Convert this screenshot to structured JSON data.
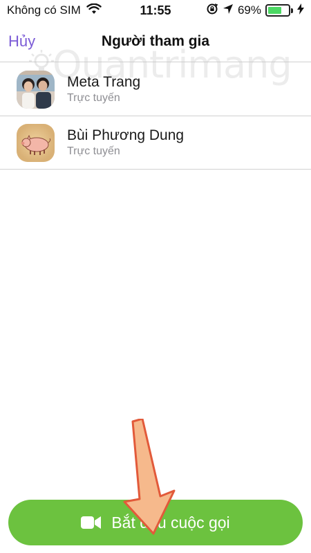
{
  "status_bar": {
    "carrier": "Không có SIM",
    "time": "11:55",
    "battery_percent": "69%",
    "battery_level": 0.69
  },
  "nav": {
    "cancel_label": "Hủy",
    "title": "Người tham gia"
  },
  "participants": [
    {
      "name": "Meta Trang",
      "status": "Trực tuyến",
      "avatar_icon": "photo-avatar"
    },
    {
      "name": "Bùi Phương Dung",
      "status": "Trực tuyến",
      "avatar_icon": "pig-avatar"
    }
  ],
  "call_button": {
    "label": "Bắt đầu cuộc gọi",
    "icon": "video-camera-icon",
    "color": "#6cc23f"
  },
  "watermark": "Quantrimang",
  "colors": {
    "accent": "#7b5bd6",
    "battery": "#4cd964",
    "arrow_fill": "#f6b98c",
    "arrow_stroke": "#e25a3a"
  }
}
